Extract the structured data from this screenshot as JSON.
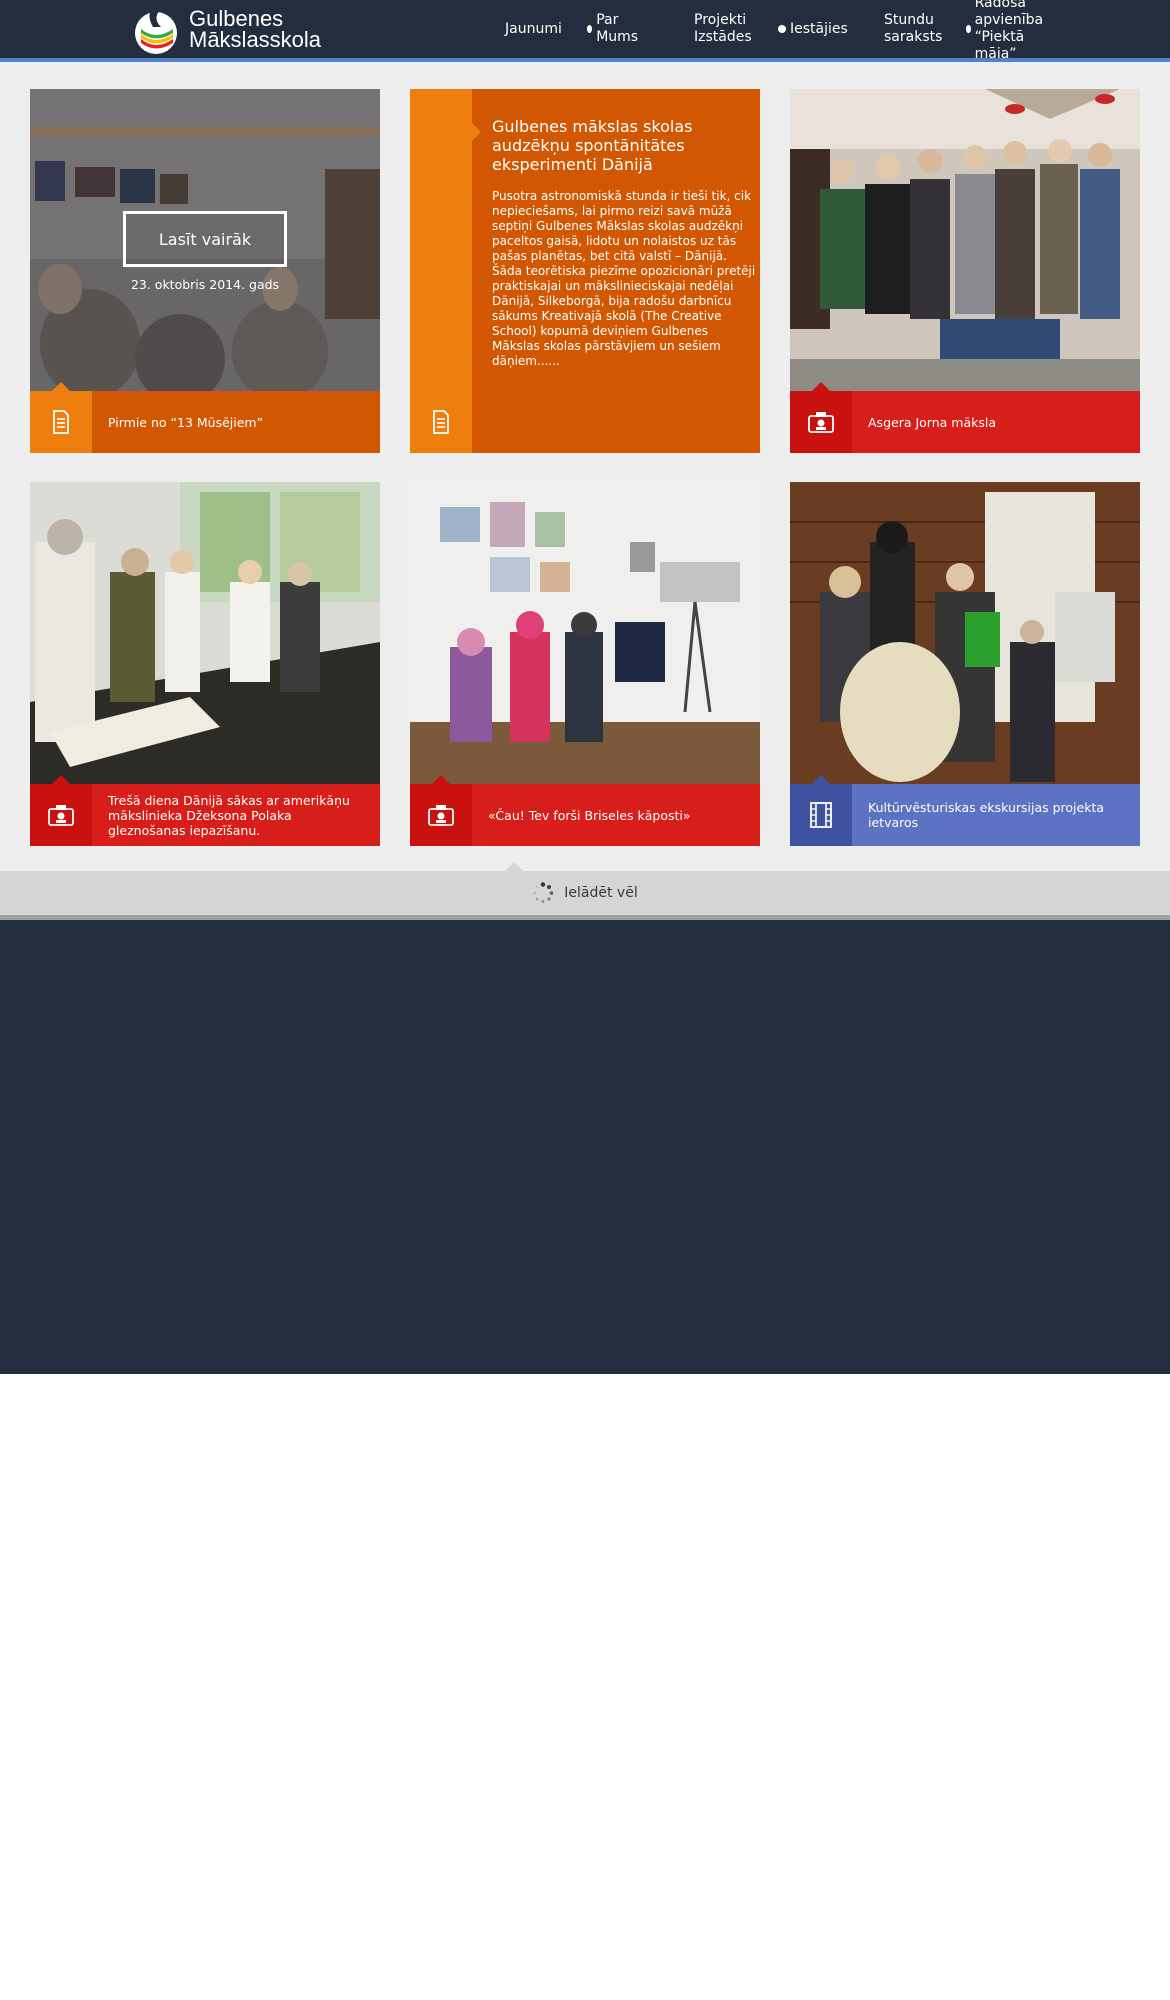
{
  "site": {
    "name_line1": "Gulbenes",
    "name_line2": "Mākslasskola"
  },
  "nav": [
    {
      "label": "Jaunumi",
      "dot": false
    },
    {
      "label": "Par Mums",
      "dot": true
    },
    {
      "label": "Projekti\nIzstādes",
      "dot": false
    },
    {
      "label": "Iestājies",
      "dot": true
    },
    {
      "label": "Stundu\nsaraksts",
      "dot": false
    },
    {
      "label": "Radošā apvienība\n“Piektā māja”",
      "dot": true
    }
  ],
  "cards": {
    "c1": {
      "caption": "Pirmie no “13 Mūsējiem”",
      "read_more": "Lasīt vairāk",
      "date": "23. oktobris 2014. gads",
      "icon": "document-icon",
      "bar_color": "#d25703",
      "icon_color": "#ee7f0e"
    },
    "c2": {
      "title": "Gulbenes mākslas skolas audzēkņu spontānitātes eksperimenti Dānijā",
      "excerpt": "Pusotra astronomiskā stunda ir tieši tik, cik nepieciešams, lai pirmo reizi savā mūžā septiņi Gulbenes Mākslas skolas audzēkņi paceltos gaisā, lidotu un nolaistos uz tās pašas planētas, bet citā valstī – Dānijā. Šāda teorētiska piezīme opozicionāri pretēji praktiskajai un mākslinieciskajai nedēļai Dānijā, Silkeborgā, bija radošu darbnīcu sākums Kreativajā skolā (The Creative School) kopumā deviņiem Gulbenes Mākslas skolas pārstāvjiem un sešiem dāņiem......",
      "icon": "document-icon"
    },
    "c3": {
      "caption": "Asgera Jorna māksla",
      "icon": "photo-gallery-icon",
      "bar_color": "#d71e1a",
      "icon_color": "#c9120f"
    },
    "c4": {
      "caption": "Trešā diena Dānijā sākas ar amerikāņu mākslinieka Džeksona Polaka gleznošanas iepazīšanu.",
      "icon": "photo-gallery-icon",
      "bar_color": "#d71e1a",
      "icon_color": "#c9120f"
    },
    "c5": {
      "caption": "«Čau! Tev forši Briseles kāposti»",
      "icon": "photo-gallery-icon",
      "bar_color": "#d71e1a",
      "icon_color": "#c9120f"
    },
    "c6": {
      "caption": "Kultūrvēsturiskas ekskursijas projekta ietvaros",
      "icon": "film-icon",
      "bar_color": "#5c72c2",
      "icon_color": "#3e52a0"
    }
  },
  "load_more": {
    "label": "Ielādēt vēl",
    "icon": "spinner-icon"
  }
}
